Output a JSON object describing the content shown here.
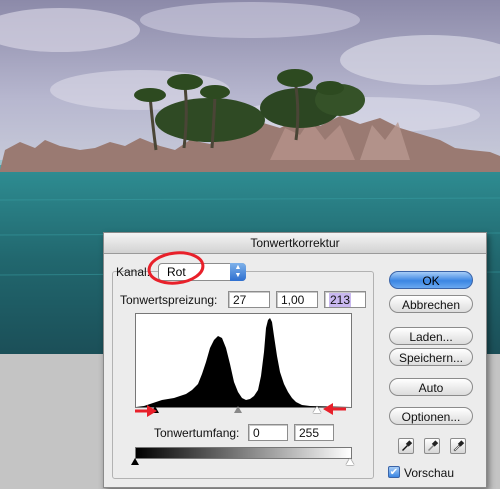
{
  "dialog": {
    "title": "Tonwertkorrektur",
    "channel_label": "Kanal:",
    "channel_value": "Rot",
    "input_levels_label": "Tonwertspreizung:",
    "input_black": "27",
    "input_gamma": "1,00",
    "input_white": "213",
    "output_levels_label": "Tonwertumfang:",
    "output_black": "0",
    "output_white": "255",
    "preview_label": "Vorschau",
    "preview_checked": true
  },
  "buttons": {
    "ok": "OK",
    "cancel": "Abbrechen",
    "load": "Laden...",
    "save": "Speichern...",
    "auto": "Auto",
    "options": "Optionen..."
  },
  "icons": {
    "channel_arrows": "up-down-arrows-icon",
    "black_point_picker": "black-eyedropper-icon",
    "gray_point_picker": "gray-eyedropper-icon",
    "white_point_picker": "white-eyedropper-icon",
    "checkmark": "checkmark-icon"
  },
  "colors": {
    "highlight": "#c9b8f0",
    "annotation": "#e8202a",
    "default_button": "#3b86e3"
  }
}
